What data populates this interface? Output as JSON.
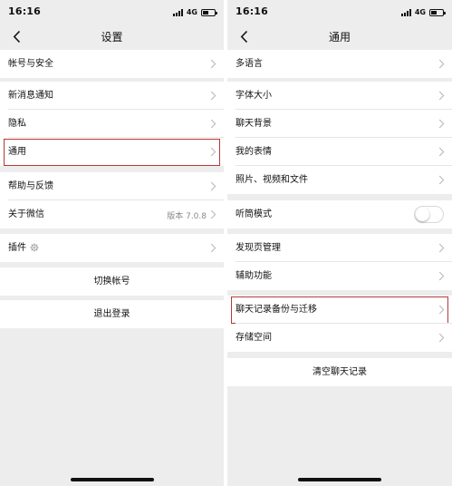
{
  "left": {
    "status": {
      "time": "16:16",
      "network": "4G"
    },
    "nav": {
      "title": "设置"
    },
    "rows": {
      "account_security": "帐号与安全",
      "new_message_notice": "新消息通知",
      "privacy": "隐私",
      "general": "通用",
      "help_feedback": "帮助与反馈",
      "about": "关于微信",
      "about_version": "版本 7.0.8",
      "plugins": "插件",
      "switch_account": "切换帐号",
      "logout": "退出登录"
    }
  },
  "right": {
    "status": {
      "time": "16:16",
      "network": "4G"
    },
    "nav": {
      "title": "通用"
    },
    "rows": {
      "language": "多语言",
      "font_size": "字体大小",
      "chat_background": "聊天背景",
      "my_stickers": "我的表情",
      "photos_videos_files": "照片、视频和文件",
      "earpiece_mode": "听筒模式",
      "discover_management": "发现页管理",
      "accessibility": "辅助功能",
      "chat_backup_migration": "聊天记录备份与迁移",
      "storage": "存储空间",
      "clear_chat_history": "清空聊天记录"
    },
    "earpiece_mode_enabled": false
  },
  "colors": {
    "background": "#ededed",
    "cell": "#ffffff",
    "highlight_border": "#b7373b",
    "secondary_text": "#8a8a8a"
  },
  "icons": [
    "back-chevron-icon",
    "chevron-right-icon",
    "gear-icon",
    "signal-icon",
    "battery-icon"
  ]
}
